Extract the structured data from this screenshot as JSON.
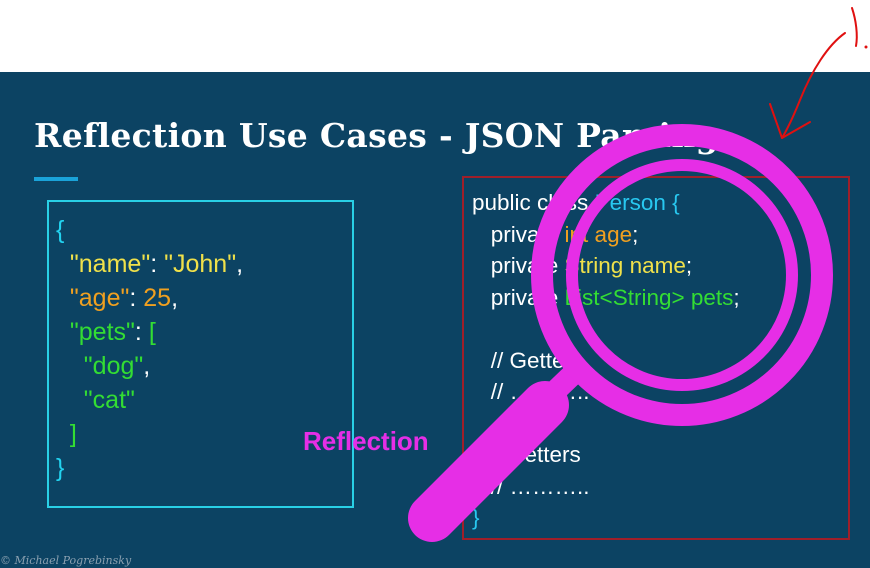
{
  "slide": {
    "title": "Reflection Use Cases - JSON Parsing",
    "overlay_label": "Reflection",
    "copyright": "© Michael Pogrebinsky"
  },
  "json_code": [
    [
      {
        "t": "{",
        "c": "c-bracket"
      }
    ],
    [
      {
        "t": "  ",
        "c": "c-white"
      },
      {
        "t": "\"name\"",
        "c": "c-key"
      },
      {
        "t": ": ",
        "c": "c-white"
      },
      {
        "t": "\"John\"",
        "c": "c-str"
      },
      {
        "t": ",",
        "c": "c-white"
      }
    ],
    [
      {
        "t": "  ",
        "c": "c-white"
      },
      {
        "t": "\"age\"",
        "c": "c-age"
      },
      {
        "t": ": ",
        "c": "c-white"
      },
      {
        "t": "25",
        "c": "c-age"
      },
      {
        "t": ",",
        "c": "c-white"
      }
    ],
    [
      {
        "t": "  ",
        "c": "c-white"
      },
      {
        "t": "\"pets\"",
        "c": "c-green"
      },
      {
        "t": ": ",
        "c": "c-white"
      },
      {
        "t": "[",
        "c": "c-green"
      }
    ],
    [
      {
        "t": "    ",
        "c": "c-white"
      },
      {
        "t": "\"dog\"",
        "c": "c-green"
      },
      {
        "t": ",",
        "c": "c-white"
      }
    ],
    [
      {
        "t": "    ",
        "c": "c-white"
      },
      {
        "t": "\"cat\"",
        "c": "c-green"
      }
    ],
    [
      {
        "t": "  ",
        "c": "c-white"
      },
      {
        "t": "]",
        "c": "c-green"
      }
    ],
    [
      {
        "t": "}",
        "c": "c-bracket"
      }
    ]
  ],
  "java_code": [
    [
      {
        "t": "public class ",
        "c": "c-white"
      },
      {
        "t": "Person {",
        "c": "c-class"
      }
    ],
    [
      {
        "t": "   private ",
        "c": "c-white"
      },
      {
        "t": "int age",
        "c": "c-age"
      },
      {
        "t": ";",
        "c": "c-white"
      }
    ],
    [
      {
        "t": "   private ",
        "c": "c-white"
      },
      {
        "t": "String name",
        "c": "c-type"
      },
      {
        "t": ";",
        "c": "c-white"
      }
    ],
    [
      {
        "t": "   private ",
        "c": "c-white"
      },
      {
        "t": "List<String> pets",
        "c": "c-green"
      },
      {
        "t": ";",
        "c": "c-white"
      }
    ],
    [
      {
        "t": "",
        "c": "c-white"
      }
    ],
    [
      {
        "t": "   // Getters",
        "c": "c-white"
      }
    ],
    [
      {
        "t": "   // ………..",
        "c": "c-white"
      }
    ],
    [
      {
        "t": "",
        "c": "c-white"
      }
    ],
    [
      {
        "t": "   // Setters",
        "c": "c-white"
      }
    ],
    [
      {
        "t": "   // ………..",
        "c": "c-white"
      }
    ],
    [
      {
        "t": "}",
        "c": "c-class"
      }
    ]
  ],
  "colors": {
    "background": "#0c4363",
    "json_border": "#29d0e6",
    "java_border": "#a01f2a",
    "magnifier": "#e62ee6",
    "annotation": "#e01010"
  },
  "icons": {
    "magnifier": "magnifying-glass-icon",
    "annotation": "red-arrow-annotation"
  }
}
